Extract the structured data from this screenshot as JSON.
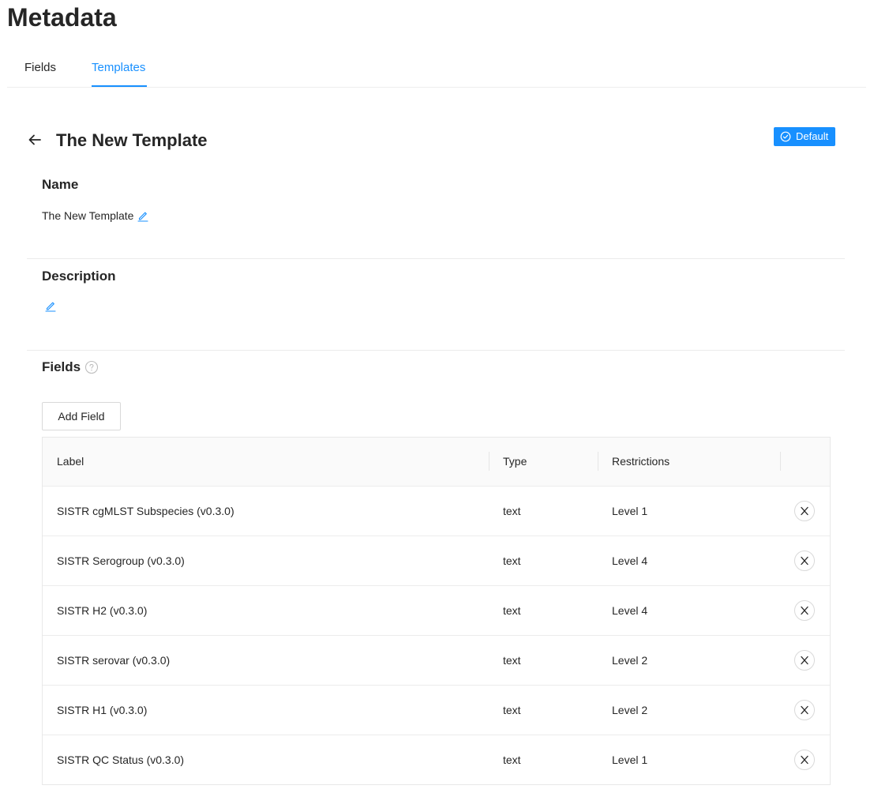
{
  "page": {
    "title": "Metadata"
  },
  "tabs": [
    {
      "label": "Fields",
      "active": false
    },
    {
      "label": "Templates",
      "active": true
    }
  ],
  "template": {
    "title": "The New Template",
    "badge": "Default",
    "name_section_title": "Name",
    "name_value": "The New Template",
    "description_section_title": "Description",
    "description_value": "",
    "fields_section_title": "Fields",
    "add_field_label": "Add Field"
  },
  "table": {
    "columns": [
      "Label",
      "Type",
      "Restrictions"
    ],
    "rows": [
      {
        "label": "SISTR cgMLST Subspecies (v0.3.0)",
        "type": "text",
        "restriction": "Level 1"
      },
      {
        "label": "SISTR Serogroup (v0.3.0)",
        "type": "text",
        "restriction": "Level 4"
      },
      {
        "label": "SISTR H2 (v0.3.0)",
        "type": "text",
        "restriction": "Level 4"
      },
      {
        "label": "SISTR serovar (v0.3.0)",
        "type": "text",
        "restriction": "Level 2"
      },
      {
        "label": "SISTR H1 (v0.3.0)",
        "type": "text",
        "restriction": "Level 2"
      },
      {
        "label": "SISTR QC Status (v0.3.0)",
        "type": "text",
        "restriction": "Level 1"
      }
    ]
  },
  "icons": {
    "back": "arrow-left-icon",
    "badge": "check-circle-icon",
    "edit": "pencil-icon",
    "help": "question-circle-icon",
    "remove": "close-icon"
  },
  "colors": {
    "accent": "#1890ff",
    "text": "#262626",
    "border": "#d9d9d9",
    "header_bg": "#fafafa"
  }
}
